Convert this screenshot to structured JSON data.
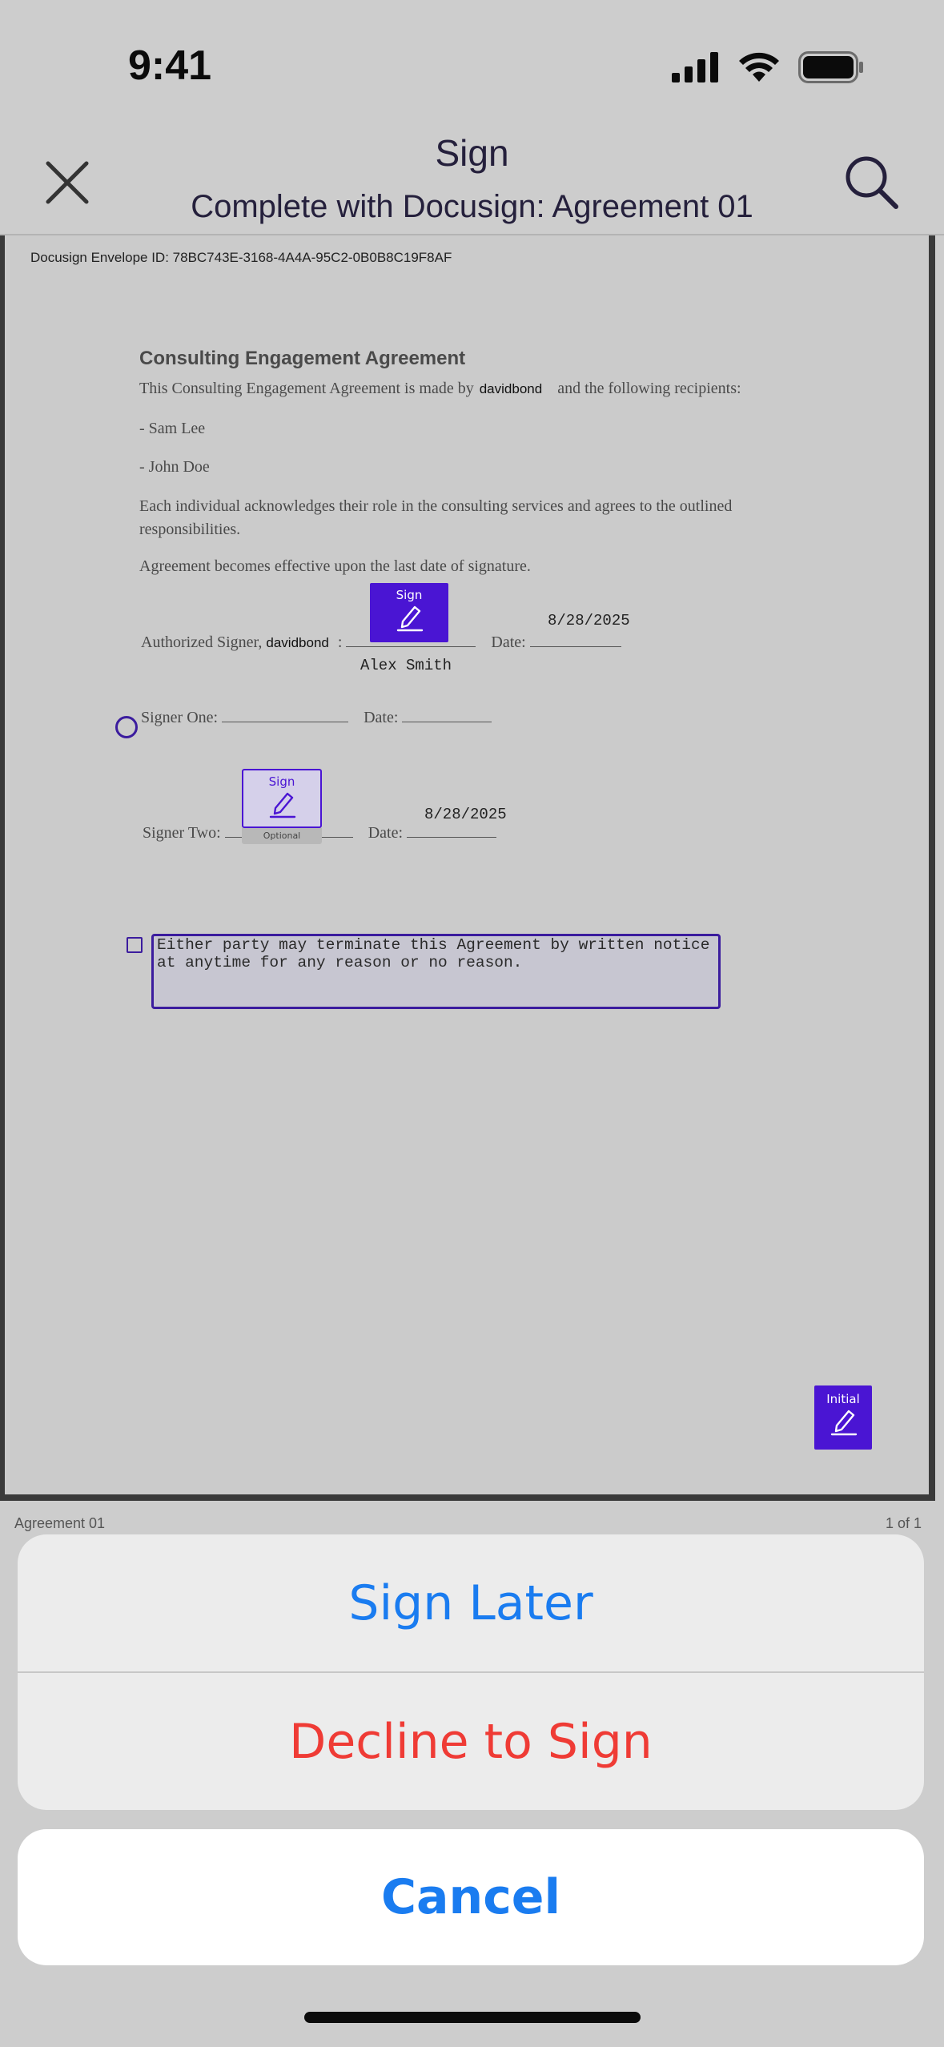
{
  "status_bar": {
    "time": "9:41"
  },
  "header": {
    "title": "Sign",
    "subtitle": "Complete with Docusign: Agreement 01"
  },
  "document": {
    "envelope_id": "Docusign Envelope ID: 78BC743E-3168-4A4A-95C2-0B0B8C19F8AF",
    "title": "Consulting Engagement Agreement",
    "intro_prefix": "This Consulting Engagement Agreement is made by",
    "intro_sender": "davidbond",
    "intro_suffix": "and the following recipients:",
    "recipients": [
      "- Sam Lee",
      "- John Doe"
    ],
    "para_acknowledge": "Each individual acknowledges their role in the consulting services and agrees to the outlined responsibilities.",
    "para_effective": "Agreement becomes effective upon the last date of signature.",
    "authorized_signer_label": "Authorized Signer,",
    "authorized_signer_name": "davidbond",
    "authorized_signer_colon": ":",
    "authorized_signer_signature_name": "Alex Smith",
    "date_label": "Date:",
    "authorized_date": "8/28/2025",
    "signer_one_label": "Signer One:",
    "signer_two_label": "Signer Two:",
    "signer_two_date": "8/28/2025",
    "sign_tag_label": "Sign",
    "optional_label": "Optional",
    "initial_tag_label": "Initial",
    "termination_text": "Either party may terminate this Agreement by written notice at anytime for any reason or no reason."
  },
  "page_footer": {
    "doc_name": "Agreement 01",
    "page_count": "1 of 1"
  },
  "action_sheet": {
    "sign_later": "Sign Later",
    "decline": "Decline to Sign",
    "cancel": "Cancel"
  },
  "colors": {
    "accent_purple": "#4a15d3",
    "ios_blue": "#1a7cf0",
    "ios_red": "#ef3b35"
  }
}
